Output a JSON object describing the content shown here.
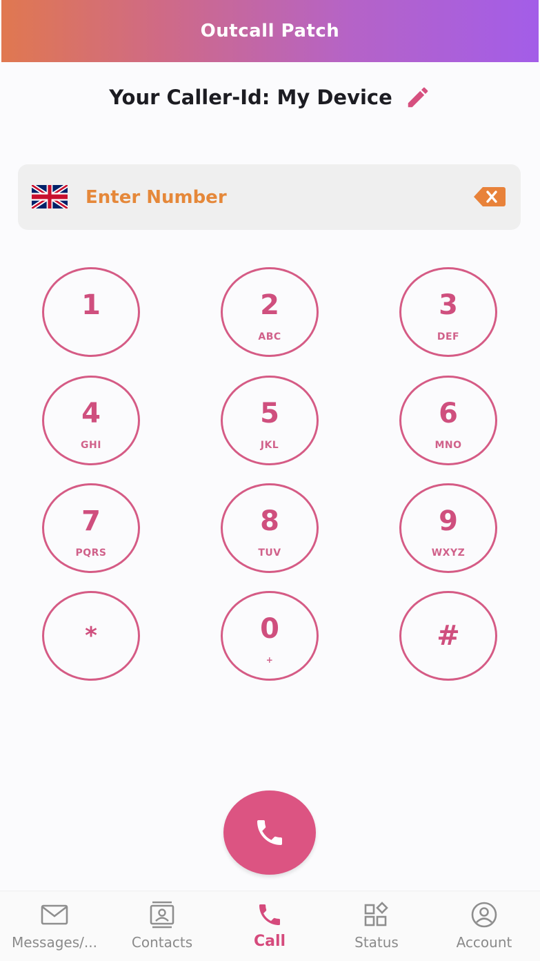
{
  "header": {
    "title": "Outcall Patch"
  },
  "caller": {
    "text": "Your Caller-Id: My Device",
    "edit_icon": "pencil-icon"
  },
  "number_bar": {
    "placeholder": "Enter Number",
    "value": "",
    "flag_icon": "uk-flag-icon",
    "backspace_icon": "backspace-icon"
  },
  "keypad": [
    {
      "digit": "1",
      "letters": ""
    },
    {
      "digit": "2",
      "letters": "ABC"
    },
    {
      "digit": "3",
      "letters": "DEF"
    },
    {
      "digit": "4",
      "letters": "GHI"
    },
    {
      "digit": "5",
      "letters": "JKL"
    },
    {
      "digit": "6",
      "letters": "MNO"
    },
    {
      "digit": "7",
      "letters": "PQRS"
    },
    {
      "digit": "8",
      "letters": "TUV"
    },
    {
      "digit": "9",
      "letters": "WXYZ"
    },
    {
      "digit": "*",
      "letters": ""
    },
    {
      "digit": "0",
      "letters": "+"
    },
    {
      "digit": "#",
      "letters": ""
    }
  ],
  "call_button": {
    "icon": "phone-icon"
  },
  "nav": {
    "items": [
      {
        "label": "Messages/...",
        "icon": "envelope-icon",
        "active": false
      },
      {
        "label": "Contacts",
        "icon": "contact-card-icon",
        "active": false
      },
      {
        "label": "Call",
        "icon": "phone-icon",
        "active": true
      },
      {
        "label": "Status",
        "icon": "widgets-icon",
        "active": false
      },
      {
        "label": "Account",
        "icon": "account-circle-icon",
        "active": false
      }
    ]
  },
  "colors": {
    "accent": "#d55b85",
    "input_text": "#e5883a",
    "header_start": "#e07850",
    "header_end": "#a35de8"
  }
}
